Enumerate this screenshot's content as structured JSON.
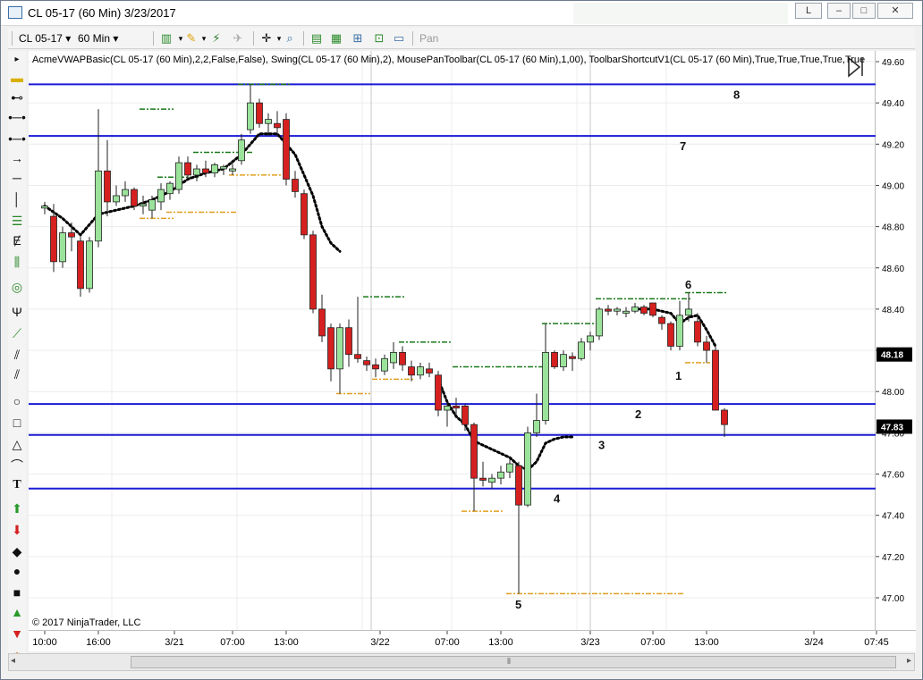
{
  "window": {
    "title": "CL 05-17 (60 Min)  3/23/2017",
    "controls": {
      "restore": "L",
      "minimize": "–",
      "maximize": "□",
      "close": "✕"
    }
  },
  "toolbar": {
    "instrument": "CL 05-17",
    "interval": "60 Min",
    "pan_label": "Pan"
  },
  "chart": {
    "indicator_label": "AcmeVWAPBasic(CL 05-17 (60 Min),2,2,False,False), Swing(CL 05-17 (60 Min),2), MousePanToolbar(CL 05-17 (60 Min),1,00), ToolbarShortcutV1(CL 05-17 (60 Min),True,True,True,True,True",
    "copyright": "© 2017 NinjaTrader, LLC",
    "price_axis": {
      "min": 47.0,
      "max": 49.6,
      "ticks": [
        "49.60",
        "49.40",
        "49.20",
        "49.00",
        "48.80",
        "48.60",
        "48.40",
        "48.20",
        "48.00",
        "47.80",
        "47.60",
        "47.40",
        "47.20",
        "47.00"
      ],
      "markers": [
        {
          "label": "48.18",
          "price": 48.18
        },
        {
          "label": "47.83",
          "price": 47.83
        }
      ]
    },
    "time_axis": {
      "labels": [
        "10:00",
        "16:00",
        "3/21",
        "07:00",
        "13:00",
        "3/22",
        "07:00",
        "13:00",
        "3/23",
        "07:00",
        "13:00",
        "3/24",
        "07:45"
      ]
    },
    "horizontal_lines": [
      {
        "label": "8",
        "price": 49.49
      },
      {
        "label": "7",
        "price": 49.24
      },
      {
        "label": "2",
        "price": 47.94
      },
      {
        "label": "3",
        "price": 47.79
      },
      {
        "label": "4",
        "price": 47.53
      }
    ],
    "point_labels": [
      "1",
      "5",
      "6"
    ],
    "colors": {
      "up": "#9be39b",
      "down": "#d62020",
      "level_line": "#1a1ad6",
      "swing_high": "#1a7a1a",
      "swing_low": "#e0a020",
      "vwap": "#000000",
      "price_marker": "#000000"
    }
  },
  "chart_data": {
    "type": "candlestick",
    "title": "CL 05-17 (60 Min)",
    "ylim": [
      47.0,
      49.6
    ],
    "candles": [
      {
        "o": 48.89,
        "h": 48.92,
        "l": 48.86,
        "c": 48.9
      },
      {
        "o": 48.85,
        "h": 48.91,
        "l": 48.58,
        "c": 48.63
      },
      {
        "o": 48.63,
        "h": 48.8,
        "l": 48.6,
        "c": 48.77
      },
      {
        "o": 48.77,
        "h": 48.82,
        "l": 48.68,
        "c": 48.75
      },
      {
        "o": 48.73,
        "h": 48.75,
        "l": 48.46,
        "c": 48.5
      },
      {
        "o": 48.5,
        "h": 48.75,
        "l": 48.48,
        "c": 48.73
      },
      {
        "o": 48.73,
        "h": 49.37,
        "l": 48.7,
        "c": 49.07
      },
      {
        "o": 49.07,
        "h": 49.22,
        "l": 48.85,
        "c": 48.92
      },
      {
        "o": 48.92,
        "h": 49.0,
        "l": 48.9,
        "c": 48.95
      },
      {
        "o": 48.95,
        "h": 49.02,
        "l": 48.92,
        "c": 48.98
      },
      {
        "o": 48.98,
        "h": 48.99,
        "l": 48.88,
        "c": 48.9
      },
      {
        "o": 48.9,
        "h": 48.95,
        "l": 48.86,
        "c": 48.91
      },
      {
        "o": 48.88,
        "h": 48.95,
        "l": 48.84,
        "c": 48.93
      },
      {
        "o": 48.92,
        "h": 49.01,
        "l": 48.88,
        "c": 48.98
      },
      {
        "o": 48.96,
        "h": 49.02,
        "l": 48.93,
        "c": 49.01
      },
      {
        "o": 48.98,
        "h": 49.14,
        "l": 48.96,
        "c": 49.11
      },
      {
        "o": 49.11,
        "h": 49.14,
        "l": 49.03,
        "c": 49.05
      },
      {
        "o": 49.05,
        "h": 49.1,
        "l": 49.02,
        "c": 49.08
      },
      {
        "o": 49.08,
        "h": 49.12,
        "l": 49.04,
        "c": 49.06
      },
      {
        "o": 49.06,
        "h": 49.11,
        "l": 49.04,
        "c": 49.1
      },
      {
        "o": 49.08,
        "h": 49.1,
        "l": 49.05,
        "c": 49.09
      },
      {
        "o": 49.07,
        "h": 49.11,
        "l": 49.05,
        "c": 49.08
      },
      {
        "o": 49.12,
        "h": 49.25,
        "l": 49.1,
        "c": 49.22
      },
      {
        "o": 49.27,
        "h": 49.49,
        "l": 49.25,
        "c": 49.4
      },
      {
        "o": 49.4,
        "h": 49.42,
        "l": 49.28,
        "c": 49.3
      },
      {
        "o": 49.3,
        "h": 49.35,
        "l": 49.24,
        "c": 49.32
      },
      {
        "o": 49.3,
        "h": 49.36,
        "l": 49.24,
        "c": 49.28
      },
      {
        "o": 49.32,
        "h": 49.35,
        "l": 49.0,
        "c": 49.03
      },
      {
        "o": 49.03,
        "h": 49.07,
        "l": 48.94,
        "c": 48.97
      },
      {
        "o": 48.96,
        "h": 48.98,
        "l": 48.74,
        "c": 48.76
      },
      {
        "o": 48.76,
        "h": 48.78,
        "l": 48.38,
        "c": 48.4
      },
      {
        "o": 48.4,
        "h": 48.47,
        "l": 48.24,
        "c": 48.27
      },
      {
        "o": 48.31,
        "h": 48.33,
        "l": 48.05,
        "c": 48.11
      },
      {
        "o": 48.11,
        "h": 48.33,
        "l": 47.99,
        "c": 48.31
      },
      {
        "o": 48.31,
        "h": 48.35,
        "l": 48.12,
        "c": 48.18
      },
      {
        "o": 48.18,
        "h": 48.46,
        "l": 48.14,
        "c": 48.16
      },
      {
        "o": 48.15,
        "h": 48.17,
        "l": 48.1,
        "c": 48.13
      },
      {
        "o": 48.13,
        "h": 48.16,
        "l": 48.07,
        "c": 48.11
      },
      {
        "o": 48.1,
        "h": 48.18,
        "l": 48.08,
        "c": 48.16
      },
      {
        "o": 48.14,
        "h": 48.24,
        "l": 48.11,
        "c": 48.19
      },
      {
        "o": 48.19,
        "h": 48.22,
        "l": 48.1,
        "c": 48.13
      },
      {
        "o": 48.12,
        "h": 48.15,
        "l": 48.05,
        "c": 48.08
      },
      {
        "o": 48.08,
        "h": 48.14,
        "l": 48.06,
        "c": 48.12
      },
      {
        "o": 48.11,
        "h": 48.14,
        "l": 48.07,
        "c": 48.09
      },
      {
        "o": 48.08,
        "h": 48.1,
        "l": 47.88,
        "c": 47.91
      },
      {
        "o": 47.91,
        "h": 47.95,
        "l": 47.83,
        "c": 47.93
      },
      {
        "o": 47.93,
        "h": 47.97,
        "l": 47.87,
        "c": 47.92
      },
      {
        "o": 47.93,
        "h": 47.94,
        "l": 47.81,
        "c": 47.84
      },
      {
        "o": 47.84,
        "h": 47.85,
        "l": 47.42,
        "c": 47.58
      },
      {
        "o": 47.58,
        "h": 47.66,
        "l": 47.54,
        "c": 47.57
      },
      {
        "o": 47.56,
        "h": 47.6,
        "l": 47.53,
        "c": 47.58
      },
      {
        "o": 47.58,
        "h": 47.64,
        "l": 47.55,
        "c": 47.61
      },
      {
        "o": 47.61,
        "h": 47.67,
        "l": 47.58,
        "c": 47.65
      },
      {
        "o": 47.64,
        "h": 47.66,
        "l": 47.02,
        "c": 47.45
      },
      {
        "o": 47.45,
        "h": 47.83,
        "l": 47.44,
        "c": 47.8
      },
      {
        "o": 47.8,
        "h": 47.99,
        "l": 47.78,
        "c": 47.86
      },
      {
        "o": 47.86,
        "h": 48.33,
        "l": 47.84,
        "c": 48.19
      },
      {
        "o": 48.19,
        "h": 48.2,
        "l": 48.11,
        "c": 48.12
      },
      {
        "o": 48.12,
        "h": 48.2,
        "l": 48.1,
        "c": 48.18
      },
      {
        "o": 48.17,
        "h": 48.19,
        "l": 48.1,
        "c": 48.16
      },
      {
        "o": 48.16,
        "h": 48.26,
        "l": 48.15,
        "c": 48.24
      },
      {
        "o": 48.24,
        "h": 48.29,
        "l": 48.2,
        "c": 48.27
      },
      {
        "o": 48.27,
        "h": 48.41,
        "l": 48.25,
        "c": 48.4
      },
      {
        "o": 48.4,
        "h": 48.42,
        "l": 48.37,
        "c": 48.39
      },
      {
        "o": 48.39,
        "h": 48.41,
        "l": 48.37,
        "c": 48.4
      },
      {
        "o": 48.38,
        "h": 48.41,
        "l": 48.36,
        "c": 48.39
      },
      {
        "o": 48.39,
        "h": 48.43,
        "l": 48.38,
        "c": 48.41
      },
      {
        "o": 48.41,
        "h": 48.42,
        "l": 48.37,
        "c": 48.38
      },
      {
        "o": 48.43,
        "h": 48.43,
        "l": 48.36,
        "c": 48.37
      },
      {
        "o": 48.36,
        "h": 48.37,
        "l": 48.3,
        "c": 48.33
      },
      {
        "o": 48.33,
        "h": 48.34,
        "l": 48.2,
        "c": 48.22
      },
      {
        "o": 48.22,
        "h": 48.44,
        "l": 48.2,
        "c": 48.37
      },
      {
        "o": 48.37,
        "h": 48.48,
        "l": 48.34,
        "c": 48.4
      },
      {
        "o": 48.34,
        "h": 48.38,
        "l": 48.22,
        "c": 48.24
      },
      {
        "o": 48.24,
        "h": 48.27,
        "l": 48.14,
        "c": 48.2
      },
      {
        "o": 48.2,
        "h": 48.22,
        "l": 47.93,
        "c": 47.91
      },
      {
        "o": 47.91,
        "h": 47.92,
        "l": 47.78,
        "c": 47.84
      }
    ],
    "vwap_segments": [
      [
        [
          0,
          48.9
        ],
        [
          2,
          48.84
        ],
        [
          4,
          48.76
        ],
        [
          6,
          48.86
        ],
        [
          8,
          48.88
        ],
        [
          10,
          48.9
        ],
        [
          12,
          48.93
        ],
        [
          14,
          48.97
        ],
        [
          16,
          49.03
        ],
        [
          18,
          49.06
        ],
        [
          20,
          49.08
        ],
        [
          22,
          49.15
        ],
        [
          24,
          49.25
        ],
        [
          26,
          49.25
        ],
        [
          28,
          49.15
        ],
        [
          30,
          48.95
        ],
        [
          31,
          48.8
        ],
        [
          32,
          48.72
        ],
        [
          33,
          48.68
        ]
      ],
      [
        [
          44,
          48.06
        ],
        [
          45,
          47.95
        ],
        [
          46,
          47.88
        ],
        [
          47,
          47.84
        ],
        [
          48,
          47.76
        ],
        [
          50,
          47.72
        ],
        [
          52,
          47.68
        ],
        [
          53,
          47.64
        ],
        [
          54,
          47.62
        ],
        [
          55,
          47.66
        ],
        [
          56,
          47.75
        ],
        [
          57,
          47.77
        ],
        [
          58,
          47.78
        ],
        [
          59,
          47.78
        ]
      ],
      [
        [
          66,
          48.4
        ],
        [
          68,
          48.4
        ],
        [
          70,
          48.38
        ],
        [
          71,
          48.33
        ],
        [
          72,
          48.36
        ],
        [
          73,
          48.37
        ],
        [
          74,
          48.3
        ],
        [
          75,
          48.22
        ]
      ]
    ],
    "swing_highs": [
      {
        "from": 11,
        "to": 14,
        "price": 49.37
      },
      {
        "from": 13,
        "to": 17,
        "price": 49.04
      },
      {
        "from": 17,
        "to": 23,
        "price": 49.16
      },
      {
        "from": 22,
        "to": 27,
        "price": 49.49
      },
      {
        "from": 36,
        "to": 40,
        "price": 48.46
      },
      {
        "from": 40,
        "to": 45,
        "price": 48.24
      },
      {
        "from": 46,
        "to": 56,
        "price": 48.12
      },
      {
        "from": 56,
        "to": 62,
        "price": 48.33
      },
      {
        "from": 62,
        "to": 72,
        "price": 48.45
      },
      {
        "from": 72,
        "to": 76,
        "price": 48.48
      }
    ],
    "swing_lows": [
      {
        "from": 11,
        "to": 14,
        "price": 48.84
      },
      {
        "from": 14,
        "to": 21,
        "price": 48.87
      },
      {
        "from": 21,
        "to": 27,
        "price": 49.05
      },
      {
        "from": 33,
        "to": 36,
        "price": 47.99
      },
      {
        "from": 37,
        "to": 41,
        "price": 48.06
      },
      {
        "from": 47,
        "to": 51,
        "price": 47.42
      },
      {
        "from": 52,
        "to": 71,
        "price": 47.02
      },
      {
        "from": 72,
        "to": 74,
        "price": 48.14
      }
    ]
  }
}
